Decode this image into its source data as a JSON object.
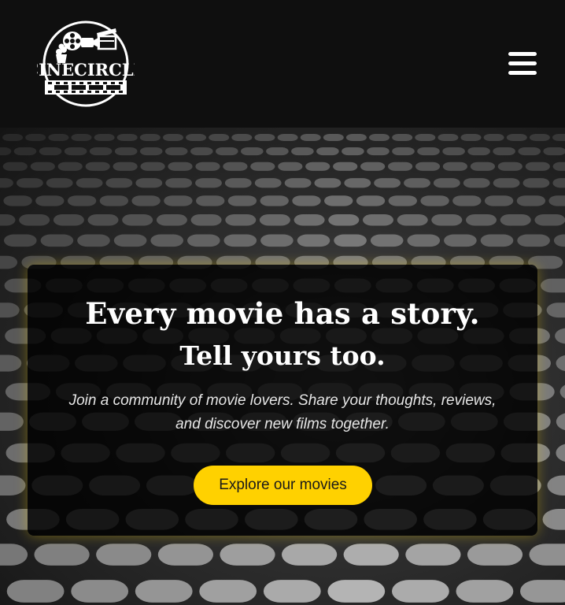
{
  "header": {
    "logo_text": "CINECIRCLE",
    "menu_icon": "hamburger-icon"
  },
  "hero": {
    "background_description_icon": "theater-seats-image",
    "headline": "Every movie has a story.",
    "subheadline": "Tell yours too.",
    "description": "Join a community of movie lovers. Share your thoughts, reviews, and discover new films together.",
    "cta_label": "Explore our movies"
  },
  "colors": {
    "background": "#0f0f0f",
    "accent": "#ffd100",
    "text": "#ffffff"
  }
}
